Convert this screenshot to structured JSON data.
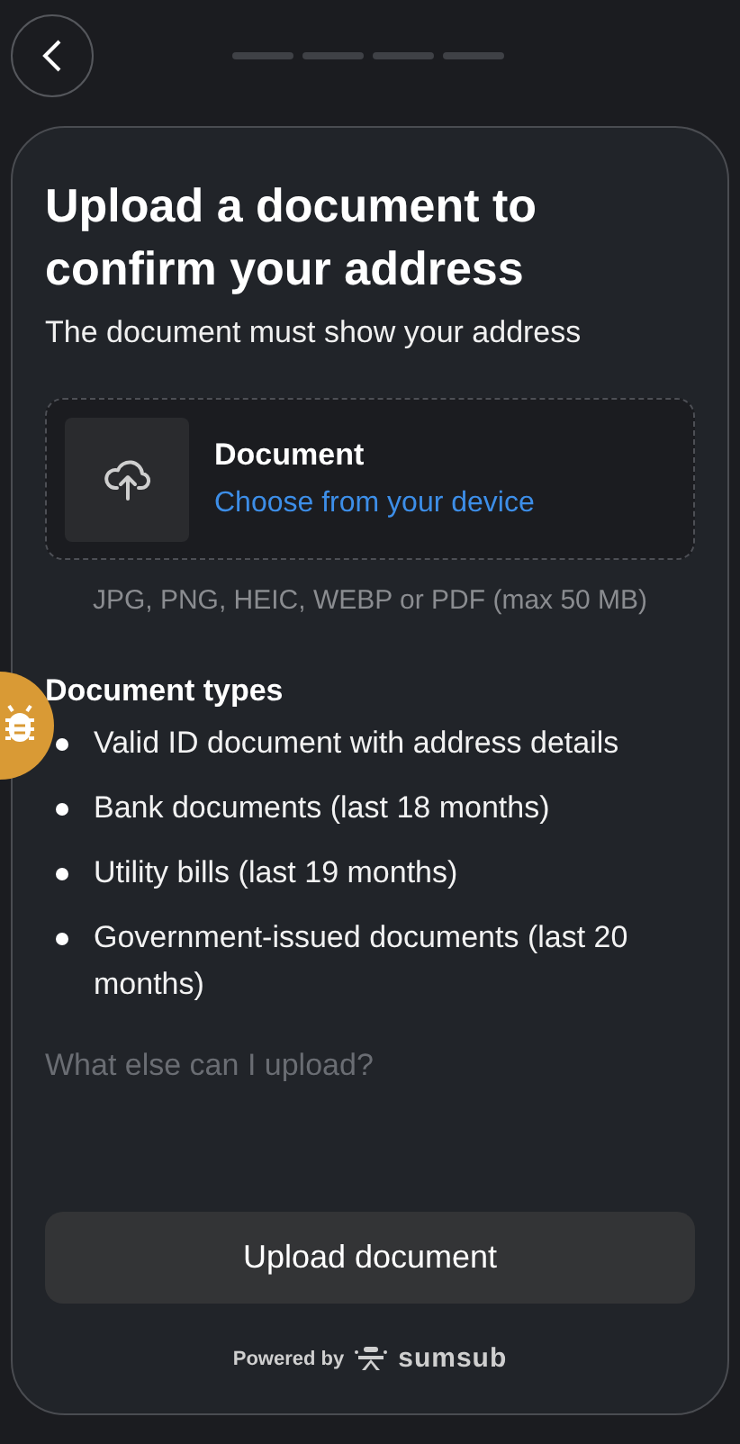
{
  "title": "Upload a document to confirm your address",
  "subtitle": "The document must show your address",
  "upload": {
    "label": "Document",
    "link": "Choose from your device"
  },
  "formats": "JPG, PNG, HEIC, WEBP or PDF (max 50 MB)",
  "types_heading": "Document types",
  "types": [
    "Valid ID document with address details",
    "Bank documents (last 18 months)",
    "Utility bills (last 19 months)",
    "Government-issued documents (last 20 months)"
  ],
  "more_link": "What else can I upload?",
  "button": "Upload document",
  "footer": {
    "powered": "Powered by",
    "brand": "sumsub"
  }
}
